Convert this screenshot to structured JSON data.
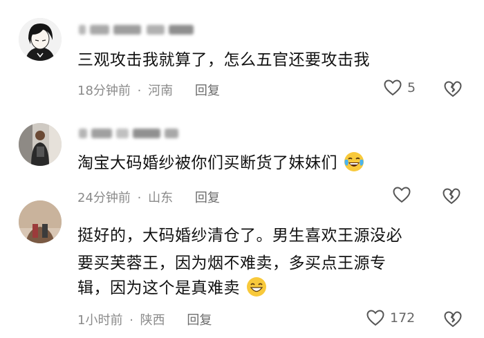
{
  "comments": [
    {
      "text": "三观攻击我就算了，怎么五官还要攻击我",
      "time": "18分钟前",
      "location": "河南",
      "reply_label": "回复",
      "likes": "5"
    },
    {
      "text": "淘宝大码婚纱被你们买断货了妹妹们",
      "time": "24分钟前",
      "location": "山东",
      "reply_label": "回复",
      "likes": ""
    },
    {
      "lines": [
        "挺好的，大码婚纱清仓了。男生喜欢王源没必",
        "要买芙蓉王，因为烟不难卖，多买点王源专",
        "辑，因为这个是真难卖"
      ],
      "time": "1小时前",
      "location": "陕西",
      "reply_label": "回复",
      "likes": "172"
    }
  ],
  "colors": {
    "text": "#111111",
    "meta": "#8a8a8a",
    "icon": "#555555"
  },
  "icons": [
    "heart-outline-icon",
    "broken-heart-icon",
    "laughing-tears-emoji",
    "smile-emoji"
  ]
}
